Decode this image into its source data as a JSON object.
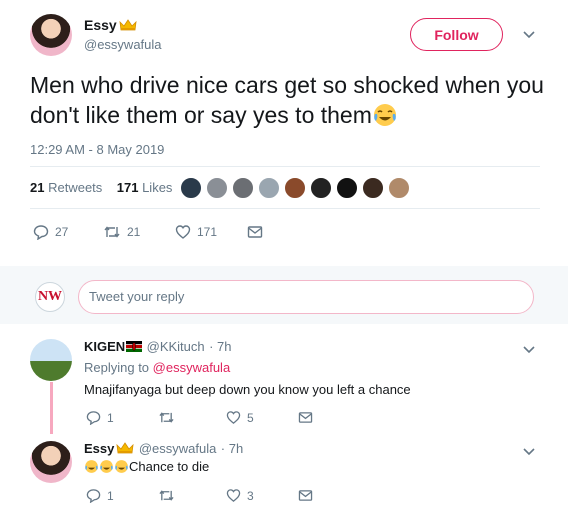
{
  "tweet": {
    "author_name": "Essy",
    "author_handle": "@essywafula",
    "follow_label": "Follow",
    "text": "Men who drive nice cars get so shocked when you don't like them or say yes to them",
    "timestamp": "12:29 AM - 8 May 2019",
    "retweets_count": "21",
    "retweets_label": "Retweets",
    "likes_count": "171",
    "likes_label": "Likes",
    "actions": {
      "replies": "27",
      "retweets": "21",
      "likes": "171"
    }
  },
  "reply_box": {
    "avatar_text": "NW",
    "placeholder": "Tweet your reply"
  },
  "replies": [
    {
      "name": "KIGEN",
      "handle": "@KKituch",
      "time": "· 7h",
      "replying_prefix": "Replying to",
      "replying_handle": "@essywafula",
      "text": "Mnajifanyaga but deep down you know you left a chance",
      "actions": {
        "replies": "1",
        "retweets": "",
        "likes": "5"
      }
    },
    {
      "name": "Essy",
      "handle": "@essywafula",
      "time": "· 7h",
      "text": "Chance to die",
      "actions": {
        "replies": "1",
        "retweets": "",
        "likes": "3"
      }
    }
  ],
  "colors": {
    "accent": "#e0245e",
    "muted": "#657786",
    "text": "#14171a",
    "divider": "#e6ecf0"
  }
}
